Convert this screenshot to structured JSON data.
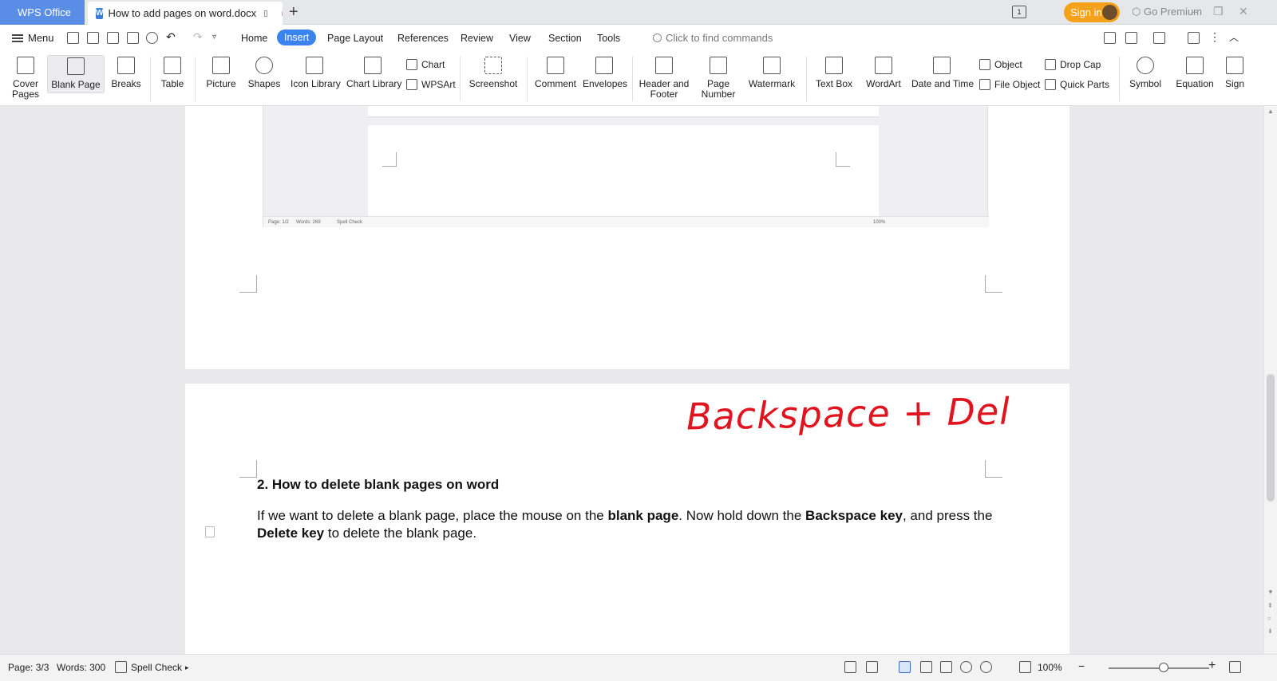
{
  "titlebar": {
    "home_label": "WPS Office",
    "doc_tab_title": "How to add pages on word.docx",
    "new_tab": "+",
    "page_indicator": "1",
    "sign_in": "Sign in",
    "premium": "Go Premium",
    "minimize": "–",
    "restore": "❐",
    "close": "✕"
  },
  "menubar": {
    "menu_label": "Menu",
    "tabs": [
      "Home",
      "Insert",
      "Page Layout",
      "References",
      "Review",
      "View",
      "Section",
      "Tools"
    ],
    "active_tab": "Insert",
    "search_placeholder": "Click to find commands"
  },
  "ribbon": {
    "cover_pages": "Cover Pages",
    "blank_page": "Blank Page",
    "breaks": "Breaks",
    "table": "Table",
    "picture": "Picture",
    "shapes": "Shapes",
    "icon_library": "Icon Library",
    "chart_library": "Chart Library",
    "chart": "Chart",
    "wpsart": "WPSArt",
    "screenshot": "Screenshot",
    "comment": "Comment",
    "envelopes": "Envelopes",
    "header_footer": "Header and Footer",
    "page_number": "Page Number",
    "watermark": "Watermark",
    "text_box": "Text Box",
    "wordart": "WordArt",
    "date_time": "Date and Time",
    "object": "Object",
    "file_object": "File Object",
    "drop_cap": "Drop Cap",
    "quick_parts": "Quick Parts",
    "symbol": "Symbol",
    "equation": "Equation",
    "signature": "Sign"
  },
  "embedded_screenshot": {
    "page": "Page: 1/2",
    "words": "Words: 269",
    "spell": "Spell Check",
    "zoom": "100%"
  },
  "document": {
    "handwriting": "Backspace + Del",
    "heading": "2. How to delete blank pages on word",
    "para_1": "If we want to delete a blank page, place the mouse on the ",
    "para_b1": "blank page",
    "para_2": ". Now hold down the ",
    "para_b2": "Backspace key",
    "para_3": ", and press the ",
    "para_b3": "Delete key",
    "para_4": " to delete the blank page."
  },
  "statusbar": {
    "page": "Page: 3/3",
    "words": "Words: 300",
    "spell_check": "Spell Check",
    "zoom": "100%",
    "zoom_level": 0.55
  }
}
